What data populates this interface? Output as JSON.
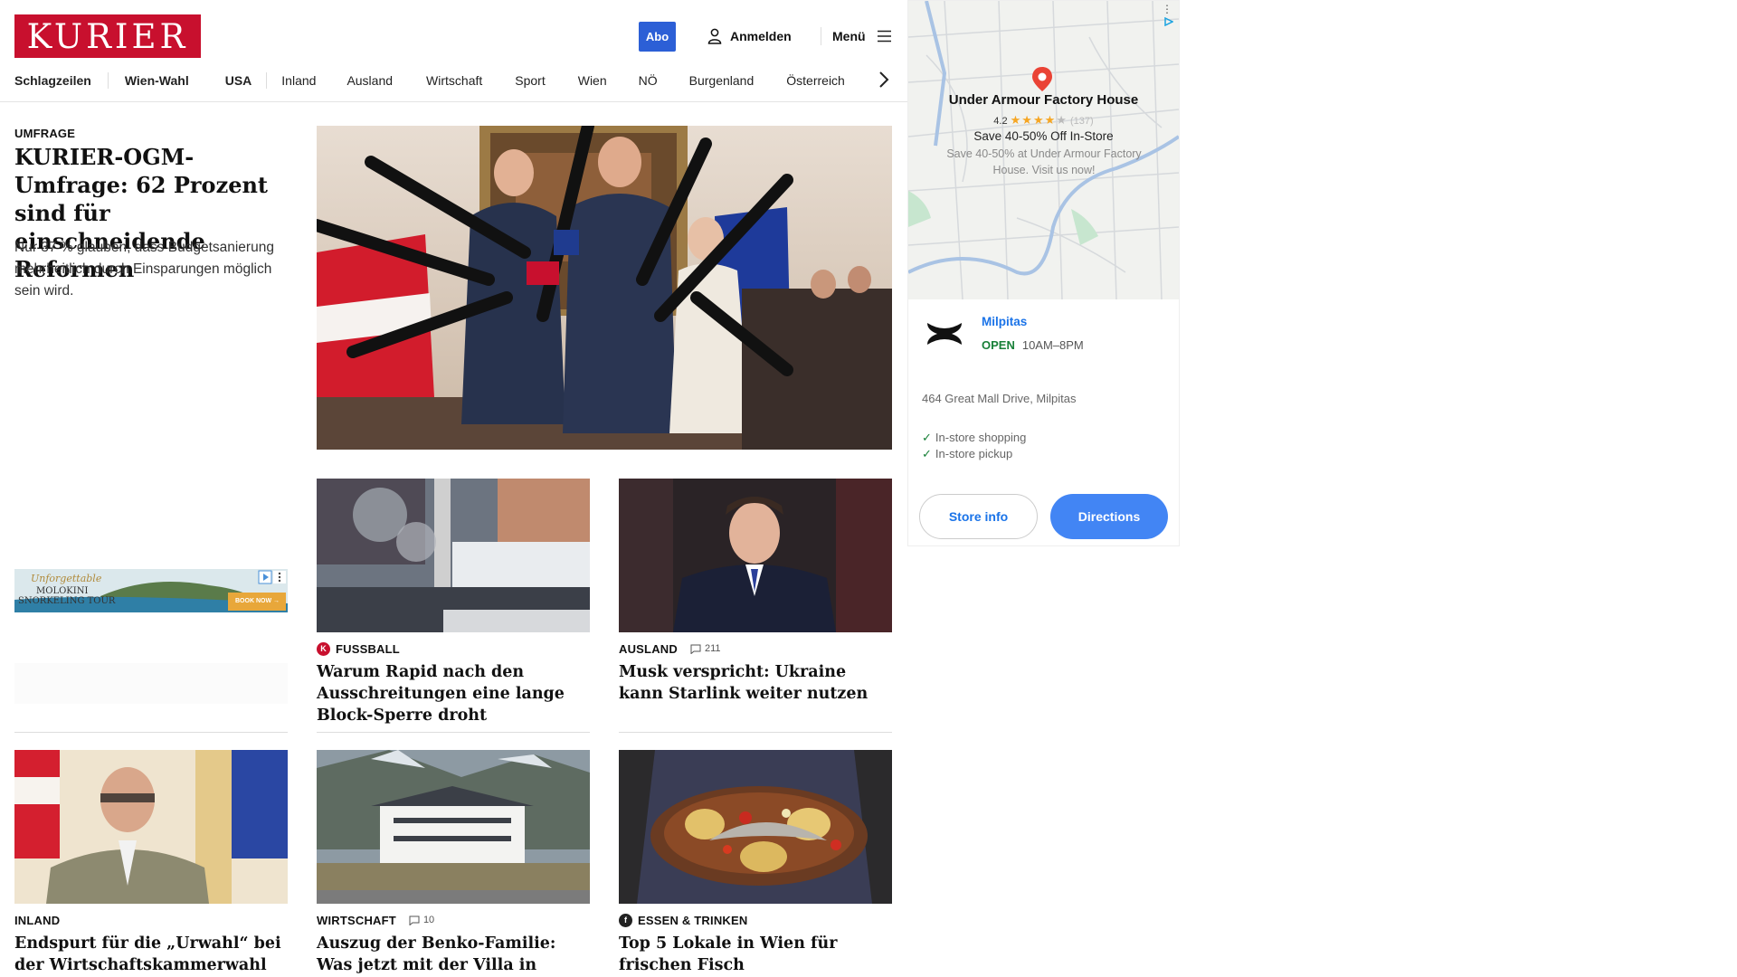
{
  "header": {
    "logo_text": "KURIER",
    "abo_label": "Abo",
    "login_label": "Anmelden",
    "menu_label": "Menü"
  },
  "nav": {
    "items": [
      "Schlagzeilen",
      "Wien-Wahl",
      "USA",
      "Inland",
      "Ausland",
      "Wirtschaft",
      "Sport",
      "Wien",
      "NÖ",
      "Burgenland",
      "Österreich"
    ]
  },
  "lead": {
    "kicker": "UMFRAGE",
    "title": "KURIER-OGM-Umfrage: 62 Prozent sind für einschneidende Reformen",
    "teaser": "Nur 37 % glauben, dass Budgetsanierung mehrheitlich durch Einsparungen möglich sein wird."
  },
  "left_ad": {
    "script_text": "Unforgettable",
    "line1": "MOLOKINI",
    "line2": "SNORKELING TOUR",
    "cta": "BOOK NOW →"
  },
  "cards": [
    {
      "kicker": "FUSSBALL",
      "badge": "K",
      "comments": "",
      "title": "Warum Rapid nach den Ausschreitungen eine lange Block-Sperre droht"
    },
    {
      "kicker": "AUSLAND",
      "badge": "",
      "comments": "211",
      "title": "Musk verspricht: Ukraine kann Starlink weiter nutzen"
    },
    {
      "kicker": "INLAND",
      "badge": "",
      "comments": "",
      "title": "Endspurt für die „Urwahl“ bei der Wirtschaftskammerwahl"
    },
    {
      "kicker": "WIRTSCHAFT",
      "badge": "",
      "comments": "10",
      "title": "Auszug der Benko-Familie: Was jetzt mit der Villa in Innsbruck geplant ist"
    },
    {
      "kicker": "ESSEN & TRINKEN",
      "badge": "f",
      "comments": "",
      "title": "Top 5 Lokale in Wien für frischen Fisch"
    }
  ],
  "map_ad": {
    "store_name": "Under Armour Factory House",
    "rating": "4.2",
    "stars_full": "★★★★",
    "stars_empty": "★",
    "review_count": "(137)",
    "promo": "Save 40-50% Off In-Store",
    "promo_sub": "Save 40-50% at Under Armour Factory House. Visit us now!",
    "city": "Milpitas",
    "open_label": "OPEN",
    "hours": "10AM–8PM",
    "address": "464 Great Mall Drive, Milpitas",
    "features": [
      "In-store shopping",
      "In-store pickup"
    ],
    "btn_info": "Store info",
    "btn_directions": "Directions"
  },
  "colors": {
    "brand_red": "#c8102e",
    "abo_blue": "#2c5fd6",
    "google_blue": "#4285f4",
    "open_green": "#188038"
  }
}
